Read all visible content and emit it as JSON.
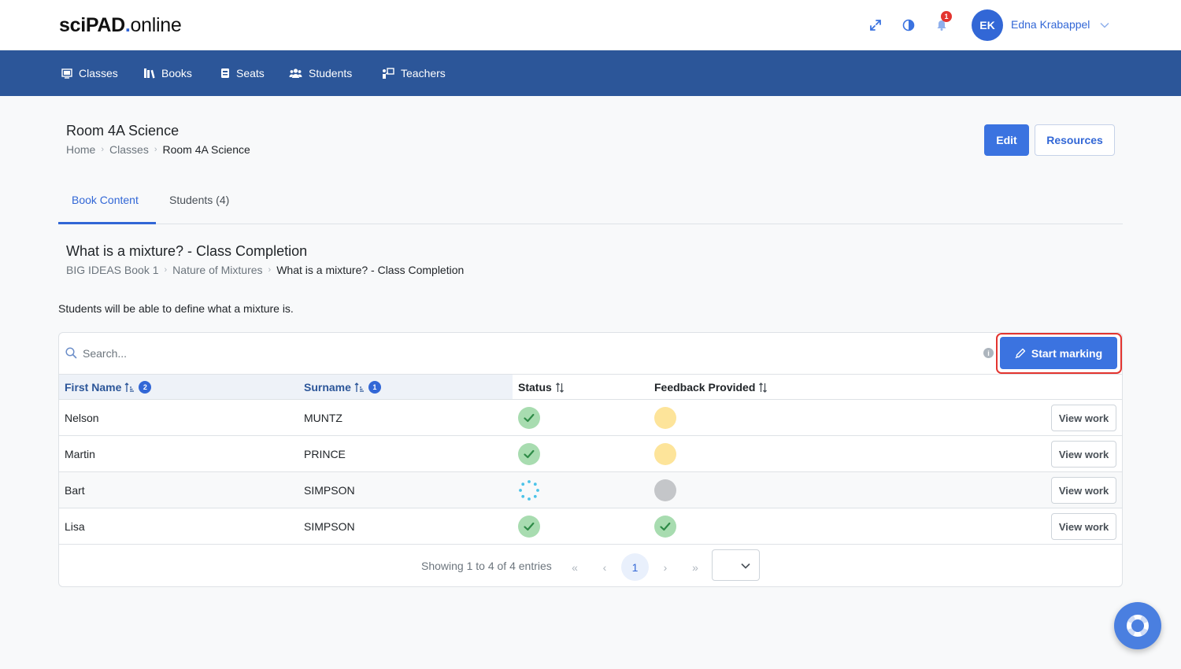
{
  "brand": {
    "part1": "sciPAD",
    "dot": ".",
    "part2": "online"
  },
  "header": {
    "notification_count": "1",
    "user_initials": "EK",
    "user_name": "Edna Krabappel"
  },
  "nav": {
    "items": [
      {
        "label": "Classes",
        "icon": "classes-icon"
      },
      {
        "label": "Books",
        "icon": "books-icon"
      },
      {
        "label": "Seats",
        "icon": "seats-icon"
      },
      {
        "label": "Students",
        "icon": "students-icon"
      },
      {
        "label": "Teachers",
        "icon": "teachers-icon"
      }
    ]
  },
  "page": {
    "title": "Room 4A Science",
    "breadcrumb": [
      "Home",
      "Classes",
      "Room 4A Science"
    ],
    "edit_label": "Edit",
    "resources_label": "Resources"
  },
  "tabs": [
    {
      "label": "Book Content",
      "active": true
    },
    {
      "label": "Students (4)",
      "active": false
    }
  ],
  "section": {
    "title": "What is a mixture? - Class Completion",
    "breadcrumb": [
      "BIG IDEAS Book 1",
      "Nature of Mixtures",
      "What is a mixture? - Class Completion"
    ],
    "objective": "Students will be able to define what a mixture is."
  },
  "table": {
    "search_placeholder": "Search...",
    "info_label": "i",
    "start_marking_label": "Start marking",
    "headers": {
      "first_name": "First Name",
      "first_name_sort": "2",
      "surname": "Surname",
      "surname_sort": "1",
      "status": "Status",
      "feedback": "Feedback Provided"
    },
    "view_label": "View work",
    "rows": [
      {
        "first": "Nelson",
        "surname": "MUNTZ",
        "status": "complete",
        "feedback": "pending"
      },
      {
        "first": "Martin",
        "surname": "PRINCE",
        "status": "complete",
        "feedback": "pending"
      },
      {
        "first": "Bart",
        "surname": "SIMPSON",
        "status": "in-progress",
        "feedback": "none"
      },
      {
        "first": "Lisa",
        "surname": "SIMPSON",
        "status": "complete",
        "feedback": "complete"
      }
    ],
    "pagination": {
      "summary": "Showing 1 to 4 of 4 entries",
      "first": "«",
      "prev": "‹",
      "current": "1",
      "next": "›",
      "last": "»"
    }
  },
  "colors": {
    "primary": "#3b73e0",
    "nav_bg": "#2c5699",
    "status_complete": "#a8dcb0",
    "status_pending": "#fde49a",
    "status_none": "#c4c6c9",
    "highlight_outline": "#e3342f"
  }
}
